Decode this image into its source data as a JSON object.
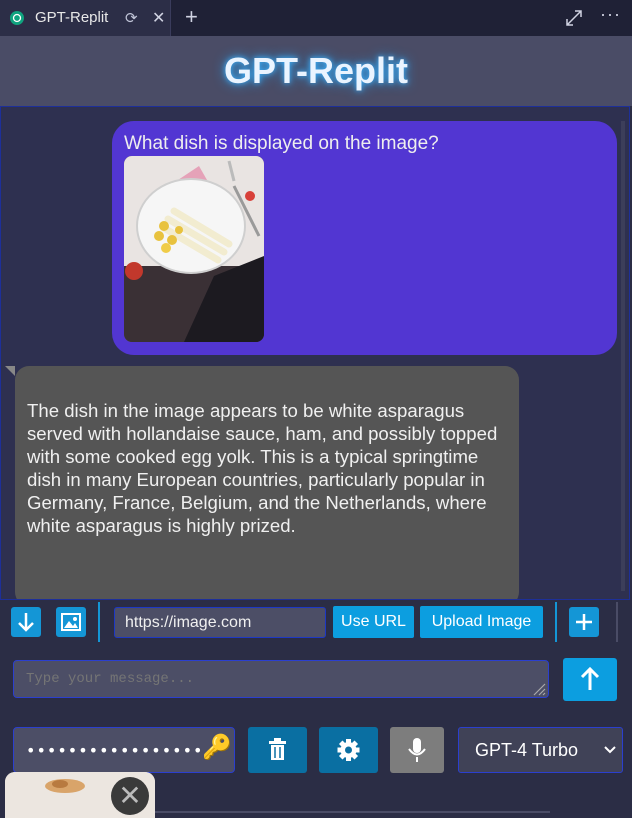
{
  "tab": {
    "title": "GPT-Replit",
    "refresh_glyph": "⟳",
    "close_glyph": "✕",
    "new_tab_glyph": "+",
    "more_glyph": "···"
  },
  "header": {
    "title": "GPT-Replit"
  },
  "chat": {
    "user_message": {
      "text": "What dish is displayed on the image?",
      "image_icon": "photo-asparagus-dish"
    },
    "assistant_message": {
      "text": "The dish in the image appears to be white asparagus served with hollandaise sauce, ham, and possibly topped with some cooked egg yolk. This is a typical springtime dish in many European countries, particularly popular in Germany, France, Belgium, and the Netherlands, where white asparagus is highly prized."
    }
  },
  "toolbar": {
    "url_value": "https://image.com",
    "use_url_label": "Use URL",
    "upload_label": "Upload Image"
  },
  "composer": {
    "placeholder": "Type your message..."
  },
  "settings": {
    "api_key_mask": "•••••••••••••••••",
    "model": "GPT-4 Turbo"
  },
  "colors": {
    "user_bubble": "#5236d2",
    "assistant_bubble": "#555555",
    "accent": "#0c9ee0",
    "background": "#2b2d45"
  }
}
